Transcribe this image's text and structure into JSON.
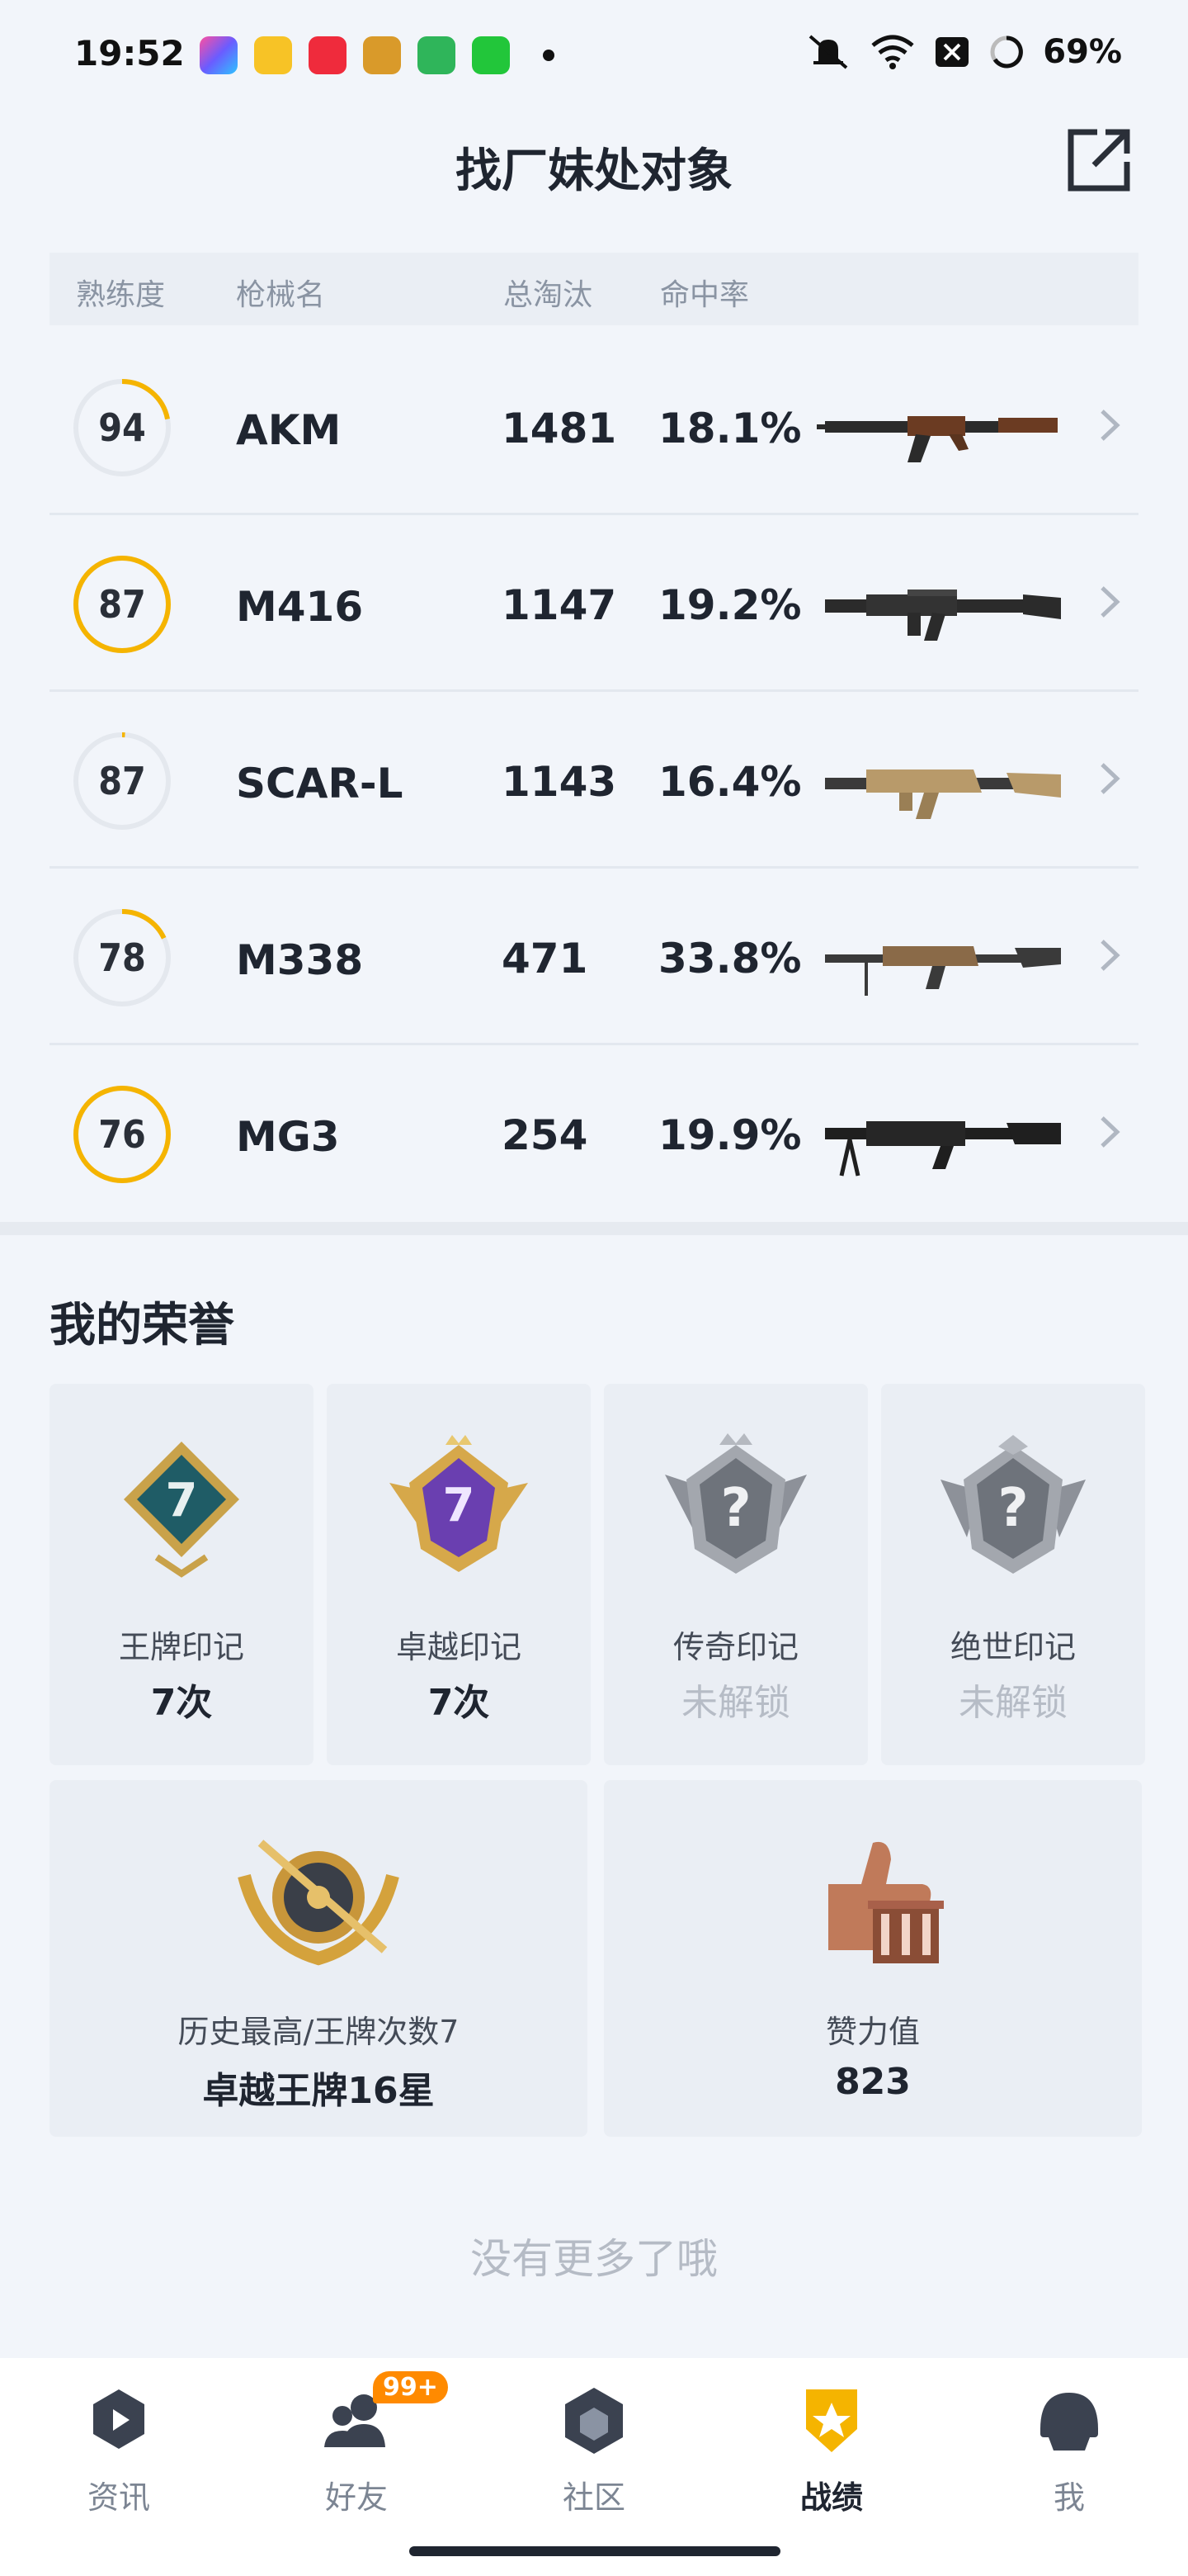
{
  "status_bar": {
    "time": "19:52",
    "battery": "69%",
    "notification_icons": [
      "app-star-icon",
      "app-target-icon",
      "music-icon",
      "game-icon",
      "shield-app-icon",
      "grid-app-icon"
    ],
    "system_icons": [
      "mute-icon",
      "wifi-icon",
      "close-box-icon",
      "battery-ring-icon"
    ]
  },
  "header": {
    "title": "找厂妹处对象",
    "share_icon": "share-external-icon"
  },
  "table": {
    "headers": {
      "proficiency": "熟练度",
      "weapon": "枪械名",
      "kills": "总淘汰",
      "hitrate": "命中率"
    },
    "rows": [
      {
        "proficiency": "94",
        "progress": 0.22,
        "ring_color": "#f5b400",
        "name": "AKM",
        "kills": "1481",
        "hitrate": "18.1%",
        "gun": "akm"
      },
      {
        "proficiency": "87",
        "progress": 1.0,
        "ring_color": "#f5b400",
        "name": "M416",
        "kills": "1147",
        "hitrate": "19.2%",
        "gun": "m416"
      },
      {
        "proficiency": "87",
        "progress": 0.01,
        "ring_color": "#f5b400",
        "name": "SCAR-L",
        "kills": "1143",
        "hitrate": "16.4%",
        "gun": "scar"
      },
      {
        "proficiency": "78",
        "progress": 0.18,
        "ring_color": "#f5b400",
        "name": "M338",
        "kills": "471",
        "hitrate": "33.8%",
        "gun": "m338"
      },
      {
        "proficiency": "76",
        "progress": 1.0,
        "ring_color": "#f5b400",
        "name": "MG3",
        "kills": "254",
        "hitrate": "19.9%",
        "gun": "mg3"
      }
    ]
  },
  "honors": {
    "title": "我的荣誉",
    "badges": [
      {
        "label": "王牌印记",
        "value": "7次",
        "locked": false,
        "badge_number": "7"
      },
      {
        "label": "卓越印记",
        "value": "7次",
        "locked": false,
        "badge_number": "7"
      },
      {
        "label": "传奇印记",
        "value": "未解锁",
        "locked": true,
        "badge_number": "?"
      },
      {
        "label": "绝世印记",
        "value": "未解锁",
        "locked": true,
        "badge_number": "?"
      }
    ],
    "wide": [
      {
        "label": "历史最高/王牌次数7",
        "value": "卓越王牌16星",
        "icon": "rank-emblem-icon"
      },
      {
        "label": "赞力值",
        "value": "823",
        "icon": "thumbs-up-icon"
      }
    ]
  },
  "footer_text": "没有更多了哦",
  "nav": {
    "items": [
      {
        "label": "资讯",
        "icon": "news-icon",
        "active": false
      },
      {
        "label": "好友",
        "icon": "friends-icon",
        "active": false,
        "badge": "99+"
      },
      {
        "label": "社区",
        "icon": "community-icon",
        "active": false
      },
      {
        "label": "战绩",
        "icon": "record-icon",
        "active": true
      },
      {
        "label": "我",
        "icon": "me-icon",
        "active": false
      }
    ]
  },
  "colors": {
    "accent": "#f5b400",
    "text": "#1f2530",
    "muted": "#8a94a3",
    "badge_orange": "#ff8a00"
  }
}
